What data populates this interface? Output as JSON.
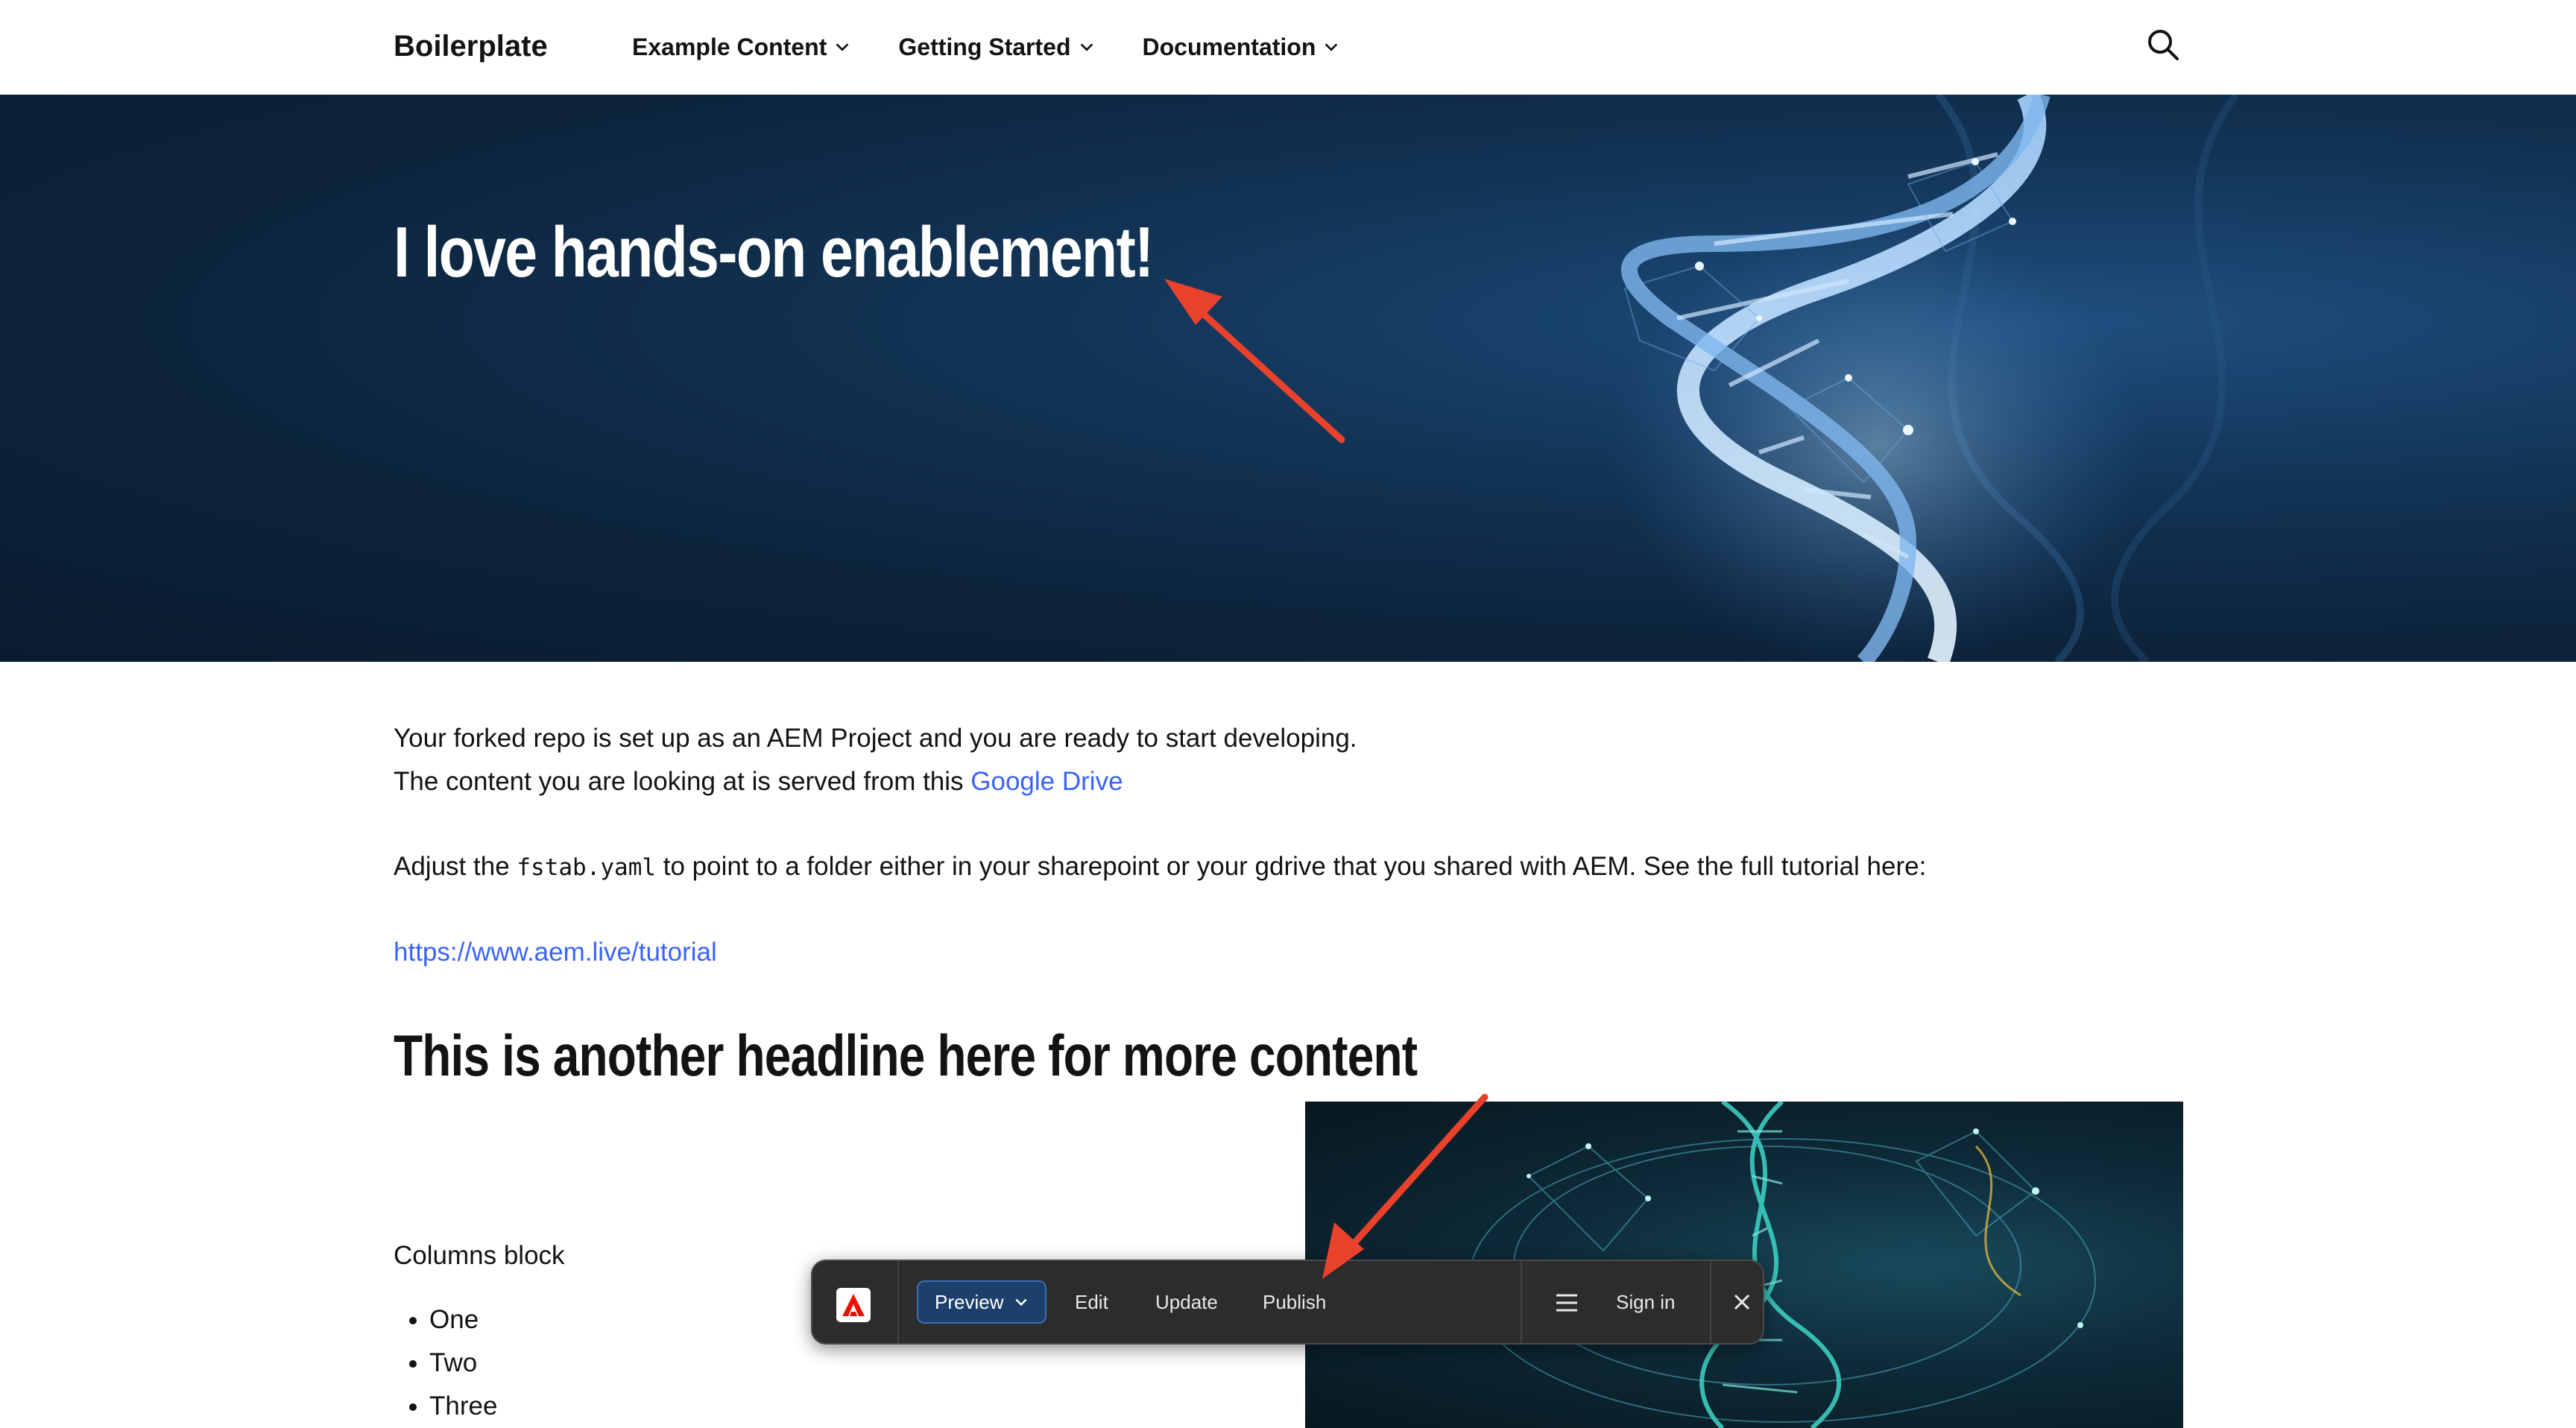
{
  "header": {
    "brand": "Boilerplate",
    "nav": [
      {
        "label": "Example Content"
      },
      {
        "label": "Getting Started"
      },
      {
        "label": "Documentation"
      }
    ]
  },
  "hero": {
    "title": "I love hands-on enablement!"
  },
  "content": {
    "p1_line1": "Your forked repo is set up as an AEM Project and you are ready to start developing.",
    "p1_line2_prefix": "The content you are looking at is served from this ",
    "p1_link": "Google Drive",
    "p2_prefix": "Adjust the ",
    "p2_code": "fstab.yaml",
    "p2_suffix": " to point to a folder either in your sharepoint or your gdrive that you shared with AEM. See the full tutorial here:",
    "tutorial_link": "https://www.aem.live/tutorial",
    "headline2": "This is another headline here for more content",
    "columns_label": "Columns block",
    "list": [
      "One",
      "Two",
      "Three"
    ]
  },
  "sidekick": {
    "preview": "Preview",
    "edit": "Edit",
    "update": "Update",
    "publish": "Publish",
    "sign_in": "Sign in"
  },
  "colors": {
    "link": "#3b63fb",
    "hero_bg": "#0d243d",
    "arrow": "#e8412c",
    "sidekick_bg": "#2c2c2c",
    "preview_bg": "#1d3f6b"
  }
}
